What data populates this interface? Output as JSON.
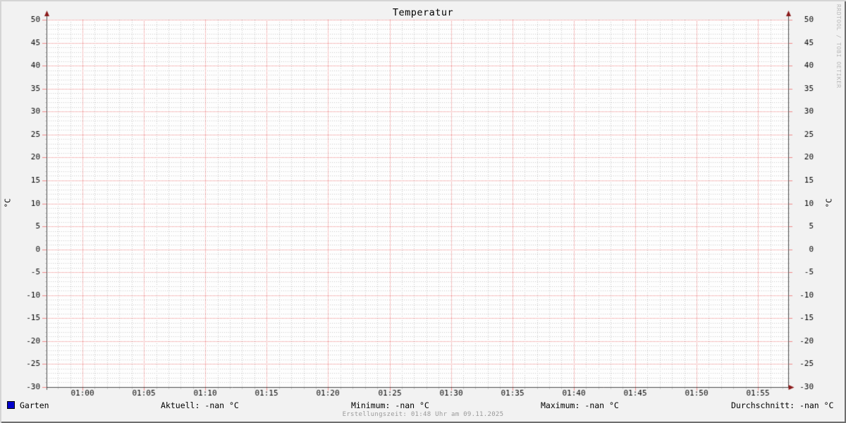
{
  "watermark": "RRDTOOL / TOBI OETIKER",
  "footer": "Erstellungszeit: 01:48 Uhr am 09.11.2025",
  "legend": {
    "series_label": "Garten",
    "series_color": "#0000cc"
  },
  "stats": [
    {
      "label": "Aktuell:",
      "value": "-nan °C"
    },
    {
      "label": "Minimum:",
      "value": "-nan °C"
    },
    {
      "label": "Maximum:",
      "value": "-nan °C"
    },
    {
      "label": "Durchschnitt:",
      "value": "-nan °C"
    }
  ],
  "colors": {
    "background": "#f2f2f2",
    "canvas": "#fefefe",
    "grid_minor": "#c9c9c9",
    "grid_major": "#ef8888",
    "axis": "#4a4a4a",
    "arrow": "#8b1a1a",
    "text": "#000000",
    "muted": "#9a9a9a",
    "watermark": "#b8b8b8",
    "shade_light": "#d5d5d5",
    "shade_dark": "#6e6e6e"
  },
  "chart_data": {
    "type": "line",
    "title": "Temperatur",
    "ylabel": "°C",
    "ylabel_right": "°C",
    "ylim": [
      -30,
      50
    ],
    "y_major_step": 5,
    "y_minor_step": 1,
    "y_tick_labels": [
      "50",
      "45",
      "40",
      "35",
      "30",
      "25",
      "20",
      "15",
      "10",
      "5",
      "0",
      "-5",
      "-10",
      "-15",
      "-20",
      "-25",
      "-30"
    ],
    "x_tick_labels": [
      "01:00",
      "01:05",
      "01:10",
      "01:15",
      "01:20",
      "01:25",
      "01:30",
      "01:35",
      "01:40",
      "01:45",
      "01:50",
      "01:55"
    ],
    "x_minor_per_major": 5,
    "grid": true,
    "legend_position": "bottom",
    "series": [
      {
        "name": "Garten",
        "color": "#0000cc",
        "values": []
      }
    ]
  }
}
